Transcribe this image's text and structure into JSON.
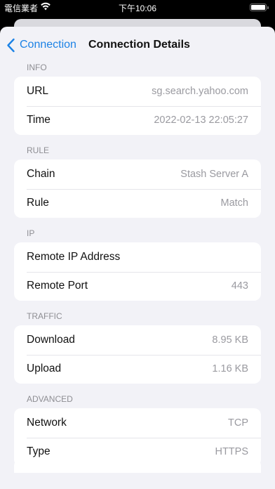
{
  "status_bar": {
    "carrier": "電信業者",
    "time": "下午10:06",
    "wifi_icon": "wifi-icon",
    "battery_icon": "battery-icon"
  },
  "nav": {
    "back_label": "Connection",
    "back_icon": "chevron-left-icon",
    "title": "Connection Details",
    "accent_color": "#1c82e5"
  },
  "sections": {
    "info": {
      "header": "INFO",
      "rows": [
        {
          "label": "URL",
          "value": "sg.search.yahoo.com"
        },
        {
          "label": "Time",
          "value": "2022-02-13 22:05:27"
        }
      ]
    },
    "rule": {
      "header": "RULE",
      "rows": [
        {
          "label": "Chain",
          "value": "Stash Server A"
        },
        {
          "label": "Rule",
          "value": "Match"
        }
      ]
    },
    "ip": {
      "header": "IP",
      "rows": [
        {
          "label": "Remote IP Address",
          "value": ""
        },
        {
          "label": "Remote Port",
          "value": "443"
        }
      ]
    },
    "traffic": {
      "header": "TRAFFIC",
      "rows": [
        {
          "label": "Download",
          "value": "8.95 KB"
        },
        {
          "label": "Upload",
          "value": "1.16 KB"
        }
      ]
    },
    "advanced": {
      "header": "ADVANCED",
      "rows": [
        {
          "label": "Network",
          "value": "TCP"
        },
        {
          "label": "Type",
          "value": "HTTPS"
        }
      ]
    }
  }
}
